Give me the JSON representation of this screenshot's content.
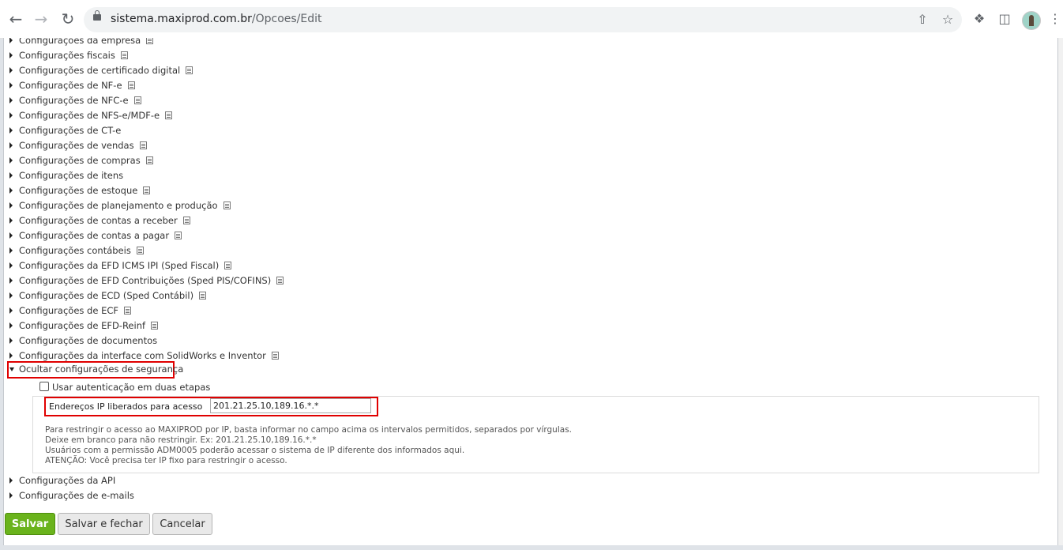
{
  "browser": {
    "url_host": "sistema.maxiprod.com.br",
    "url_path": "/Opcoes/Edit",
    "icons": [
      "back-icon",
      "forward-icon",
      "reload-icon",
      "lock-icon",
      "share-icon",
      "star-icon",
      "extensions-icon",
      "sidepanel-icon",
      "avatar",
      "menu-icon"
    ]
  },
  "sections": [
    {
      "label": "Configurações da empresa",
      "note": true
    },
    {
      "label": "Configurações fiscais",
      "note": true
    },
    {
      "label": "Configurações de certificado digital",
      "note": true
    },
    {
      "label": "Configurações de NF-e",
      "note": true
    },
    {
      "label": "Configurações de NFC-e",
      "note": true
    },
    {
      "label": "Configurações de NFS-e/MDF-e",
      "note": true
    },
    {
      "label": "Configurações de CT-e",
      "note": false
    },
    {
      "label": "Configurações de vendas",
      "note": true
    },
    {
      "label": "Configurações de compras",
      "note": true
    },
    {
      "label": "Configurações de itens",
      "note": false
    },
    {
      "label": "Configurações de estoque",
      "note": true
    },
    {
      "label": "Configurações de planejamento e produção",
      "note": true
    },
    {
      "label": "Configurações de contas a receber",
      "note": true
    },
    {
      "label": "Configurações de contas a pagar",
      "note": true
    },
    {
      "label": "Configurações contábeis",
      "note": true
    },
    {
      "label": "Configurações da EFD ICMS IPI (Sped Fiscal)",
      "note": true
    },
    {
      "label": "Configurações de EFD Contribuições (Sped PIS/COFINS)",
      "note": true
    },
    {
      "label": "Configurações de ECD (Sped Contábil)",
      "note": true
    },
    {
      "label": "Configurações de ECF",
      "note": true
    },
    {
      "label": "Configurações de EFD-Reinf",
      "note": true
    },
    {
      "label": "Configurações de documentos",
      "note": false
    },
    {
      "label": "Configurações da interface com SolidWorks e Inventor",
      "note": true
    }
  ],
  "security": {
    "toggle_label": "Ocultar configurações de segurança",
    "two_factor_label": "Usar autenticação em duas etapas",
    "two_factor_checked": false,
    "ip_label": "Endereços IP liberados para acesso",
    "ip_value": "201.21.25.10,189.16.*.*",
    "help_lines": [
      "Para restringir o acesso ao MAXIPROD por IP, basta informar no campo acima os intervalos permitidos, separados por vírgulas.",
      "Deixe em branco para não restringir. Ex: 201.21.25.10,189.16.*.*",
      "Usuários com a permissão ADM0005 poderão acessar o sistema de IP diferente dos informados aqui.",
      "ATENÇÃO: Você precisa ter IP fixo para restringir o acesso."
    ]
  },
  "after_sections": [
    {
      "label": "Configurações da API"
    },
    {
      "label": "Configurações de e-mails"
    }
  ],
  "buttons": {
    "save": "Salvar",
    "save_close": "Salvar e fechar",
    "cancel": "Cancelar"
  },
  "colors": {
    "highlight": "#e00000",
    "save_button": "#6ab31c"
  }
}
